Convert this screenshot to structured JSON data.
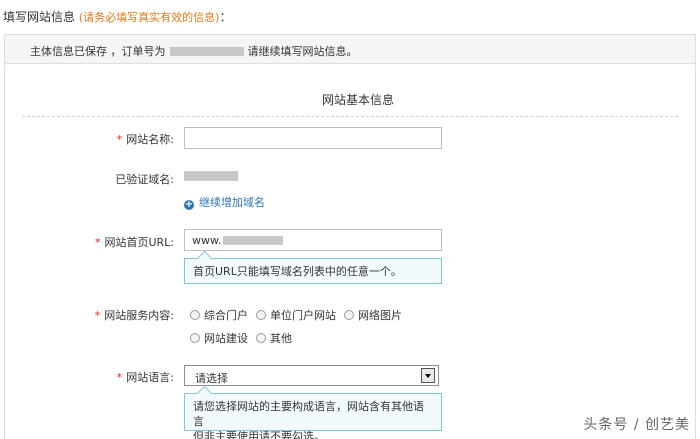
{
  "header": {
    "title": "填写网站信息",
    "note": "(请务必填写真实有效的信息)",
    "colon": "："
  },
  "status": {
    "prefix": "主体信息已保存 ，订单号为",
    "suffix": "请继续填写网站信息。"
  },
  "section": {
    "title": "网站基本信息"
  },
  "form": {
    "required_mark": "*",
    "site_name": {
      "label": "网站名称:",
      "value": ""
    },
    "verified_domain": {
      "label": "已验证域名:"
    },
    "add_domain": {
      "label": "继续增加域名",
      "icon": "plus-circle-icon"
    },
    "homepage_url": {
      "label": "网站首页URL:",
      "value_prefix": "www.",
      "tip": "首页URL只能填写域名列表中的任意一个。"
    },
    "service_content": {
      "label": "网站服务内容:",
      "options": [
        "综合门户",
        "单位门户网站",
        "网络图片",
        "网站建设",
        "其他"
      ]
    },
    "language": {
      "label": "网站语言:",
      "selected": "请选择",
      "tip_line1": "请您选择网站的主要构成语言，网站含有其他语言",
      "tip_line2": "但非主要使用请不要勾选。"
    }
  },
  "watermark": "头条号 / 创艺美"
}
